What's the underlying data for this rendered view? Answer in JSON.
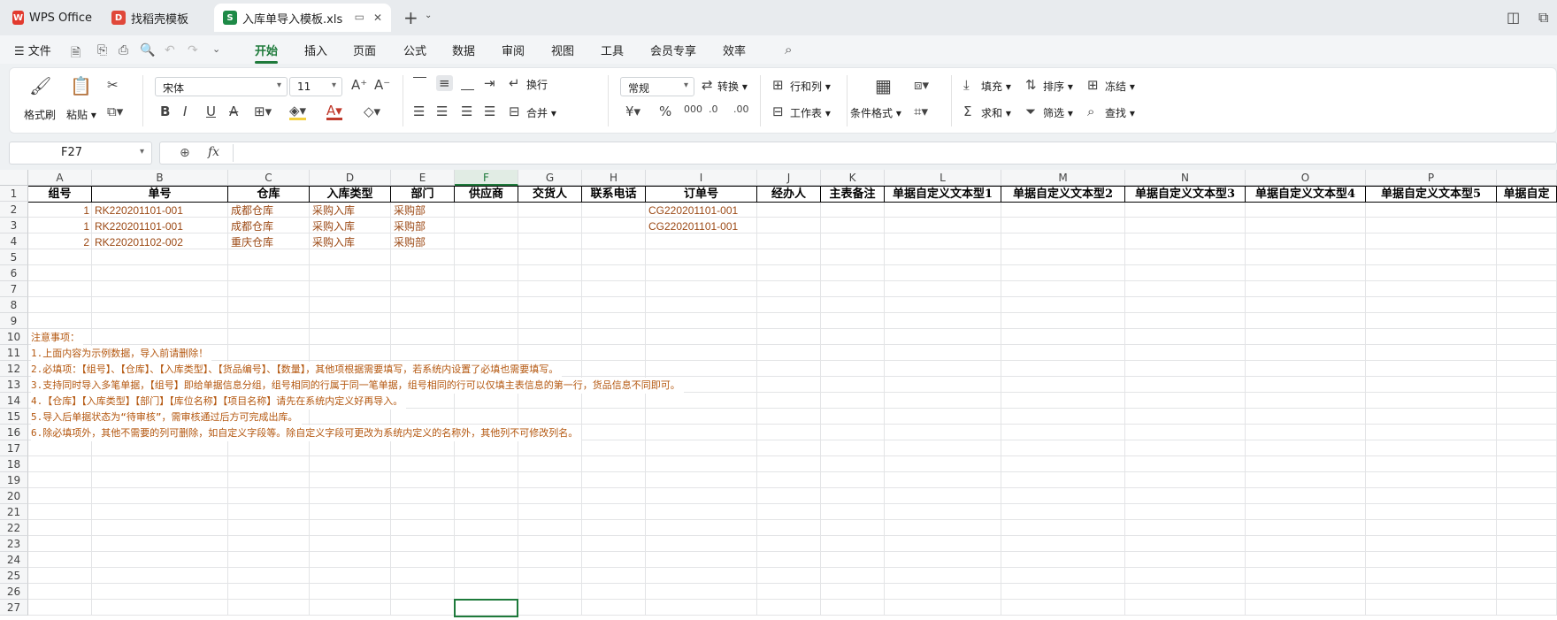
{
  "tabs": [
    {
      "label": "WPS Office"
    },
    {
      "label": "找稻壳模板"
    },
    {
      "label": "入库单导入模板.xls"
    }
  ],
  "menu": {
    "file": "文件",
    "items": [
      "开始",
      "插入",
      "页面",
      "公式",
      "数据",
      "审阅",
      "视图",
      "工具",
      "会员专享",
      "效率"
    ]
  },
  "ribbon": {
    "format_painter": "格式刷",
    "paste": "粘贴",
    "font_name": "宋体",
    "font_size": "11",
    "wrap": "换行",
    "merge": "合并",
    "number_format": "常规",
    "convert": "转换",
    "row_col": "行和列",
    "sheet": "工作表",
    "cond_format": "条件格式",
    "fill": "填充",
    "sort": "排序",
    "freeze": "冻结",
    "sum": "求和",
    "filter": "筛选",
    "find": "查找"
  },
  "formula_bar": {
    "name_box": "F27",
    "fx": "fx",
    "content": ""
  },
  "columns": [
    "A",
    "B",
    "C",
    "D",
    "E",
    "F",
    "G",
    "H",
    "I",
    "J",
    "K",
    "L",
    "M",
    "N",
    "O",
    "P",
    ""
  ],
  "rows": [
    "1",
    "2",
    "3",
    "4",
    "5",
    "6",
    "7",
    "8",
    "9",
    "10",
    "11",
    "12",
    "13",
    "14",
    "15",
    "16",
    "17",
    "18",
    "19",
    "20",
    "21",
    "22",
    "23",
    "24",
    "25",
    "26",
    "27"
  ],
  "header_row": [
    "组号",
    "单号",
    "仓库",
    "入库类型",
    "部门",
    "供应商",
    "交货人",
    "联系电话",
    "订单号",
    "经办人",
    "主表备注",
    "单据自定义文本型1",
    "单据自定义文本型2",
    "单据自定义文本型3",
    "单据自定义文本型4",
    "单据自定义文本型5",
    "单据自定"
  ],
  "data_rows": [
    {
      "group": "1",
      "no": "RK220201101-001",
      "warehouse": "成都仓库",
      "type": "采购入库",
      "dept": "采购部",
      "order": "CG220201101-001"
    },
    {
      "group": "1",
      "no": "RK220201101-001",
      "warehouse": "成都仓库",
      "type": "采购入库",
      "dept": "采购部",
      "order": "CG220201101-001"
    },
    {
      "group": "2",
      "no": "RK220201102-002",
      "warehouse": "重庆仓库",
      "type": "采购入库",
      "dept": "采购部",
      "order": ""
    }
  ],
  "notes": [
    "注意事项：",
    "1.上面内容为示例数据，导入前请删除！",
    "2.必填项：【组号】、【仓库】、【入库类型】、【货品编号】、【数量】，其他项根据需要填写，若系统内设置了必填也需要填写。",
    "3.支持同时导入多笔单据，【组号】即给单据信息分组，组号相同的行属于同一笔单据，组号相同的行可以仅填主表信息的第一行，货品信息不同即可。",
    "4.【仓库】【入库类型】【部门】【库位名称】【项目名称】请先在系统内定义好再导入。",
    "5.导入后单据状态为“待审核”，需审核通过后方可完成出库。",
    "6.除必填项外，其他不需要的列可删除，如自定义字段等。除自定义字段可更改为系统内定义的名称外，其他列不可修改列名。"
  ],
  "colors": {
    "accent": "#1e7a3b",
    "data_text": "#9c4a16",
    "note_text": "#b4570f"
  }
}
